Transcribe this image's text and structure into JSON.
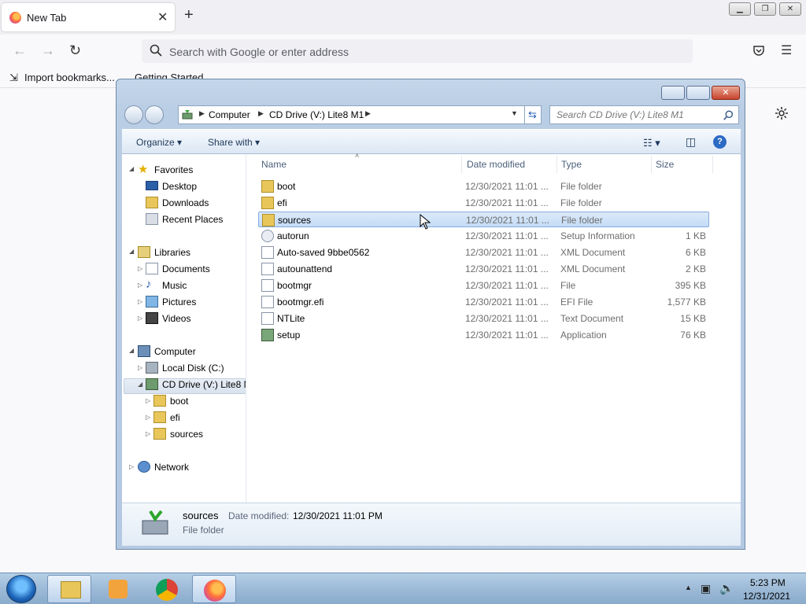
{
  "firefox": {
    "tab_title": "New Tab",
    "url_placeholder": "Search with Google or enter address",
    "bookmarks": [
      "Import bookmarks...",
      "Getting Started"
    ]
  },
  "explorer": {
    "breadcrumb": [
      "Computer",
      "CD Drive (V:) Lite8 M1"
    ],
    "search_placeholder": "Search CD Drive (V:) Lite8 M1",
    "commands": {
      "organize": "Organize",
      "share": "Share with"
    },
    "columns": {
      "name": "Name",
      "date": "Date modified",
      "type": "Type",
      "size": "Size"
    },
    "nav": {
      "favorites": "Favorites",
      "desktop": "Desktop",
      "downloads": "Downloads",
      "recent": "Recent Places",
      "libraries": "Libraries",
      "documents": "Documents",
      "music": "Music",
      "pictures": "Pictures",
      "videos": "Videos",
      "computer": "Computer",
      "local_disk": "Local Disk (C:)",
      "cd_drive": "CD Drive (V:) Lite8 M",
      "boot": "boot",
      "efi": "efi",
      "sources": "sources",
      "network": "Network"
    },
    "files": [
      {
        "name": "boot",
        "date": "12/30/2021 11:01 ...",
        "type": "File folder",
        "size": ""
      },
      {
        "name": "efi",
        "date": "12/30/2021 11:01 ...",
        "type": "File folder",
        "size": ""
      },
      {
        "name": "sources",
        "date": "12/30/2021 11:01 ...",
        "type": "File folder",
        "size": ""
      },
      {
        "name": "autorun",
        "date": "12/30/2021 11:01 ...",
        "type": "Setup Information",
        "size": "1 KB"
      },
      {
        "name": "Auto-saved 9bbe0562",
        "date": "12/30/2021 11:01 ...",
        "type": "XML Document",
        "size": "6 KB"
      },
      {
        "name": "autounattend",
        "date": "12/30/2021 11:01 ...",
        "type": "XML Document",
        "size": "2 KB"
      },
      {
        "name": "bootmgr",
        "date": "12/30/2021 11:01 ...",
        "type": "File",
        "size": "395 KB"
      },
      {
        "name": "bootmgr.efi",
        "date": "12/30/2021 11:01 ...",
        "type": "EFI File",
        "size": "1,577 KB"
      },
      {
        "name": "NTLite",
        "date": "12/30/2021 11:01 ...",
        "type": "Text Document",
        "size": "15 KB"
      },
      {
        "name": "setup",
        "date": "12/30/2021 11:01 ...",
        "type": "Application",
        "size": "76 KB"
      }
    ],
    "details": {
      "name": "sources",
      "date_label": "Date modified:",
      "date_value": "12/30/2021 11:01 PM",
      "type": "File folder"
    }
  },
  "taskbar": {
    "time": "5:23 PM",
    "date": "12/31/2021"
  }
}
